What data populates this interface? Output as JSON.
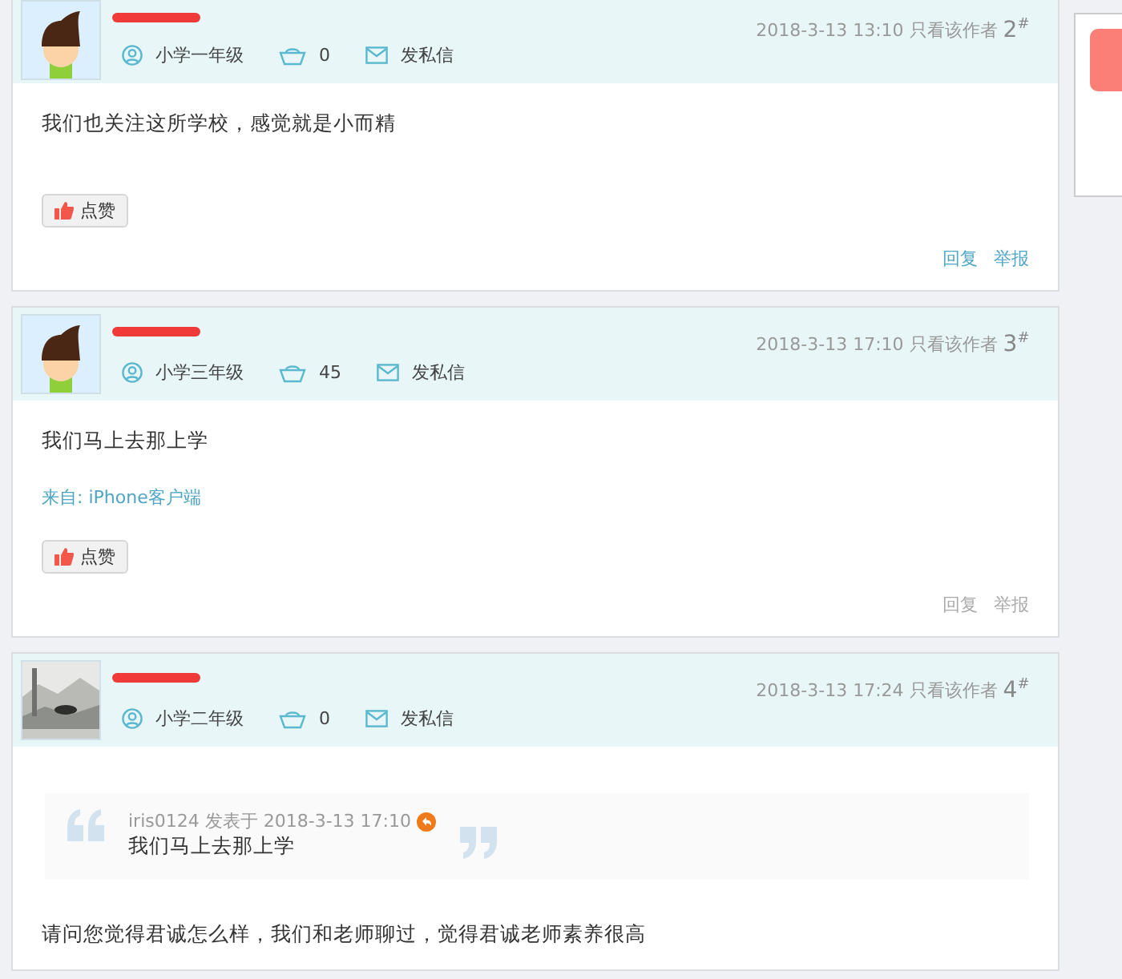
{
  "posts": [
    {
      "avatar": {
        "kind": "cartoon"
      },
      "grade": "小学一年级",
      "coins": "0",
      "message_link": "发私信",
      "time": "2018-3-13 13:10",
      "author_only": "只看该作者",
      "floor": "2$^{#}$",
      "content": "我们也关注这所学校，感觉就是小而精",
      "like_button": "点赞",
      "actions": [
        "回复",
        "举报"
      ],
      "highlighted": true
    },
    {
      "avatar": {
        "kind": "cartoon"
      },
      "grade": "小学三年级",
      "coins": "45",
      "message_link": "发私信",
      "time": "2018-3-13 17:10",
      "author_only": "只看该作者",
      "floor": "3$^{#}$",
      "content": "我们马上去那上学",
      "source": "来自: iPhone客户端",
      "like_button": "点赞",
      "actions": [
        "回复",
        "举报"
      ],
      "highlighted": false
    },
    {
      "grade": "小学二年级",
      "coins": "0",
      "message_link": "发私信",
      "time": "2018-3-13 17:24",
      "author_only": "只看该作者",
      "floor": "4$^{#}$",
      "quote": {
        "meta": "iris0124 发表于 2018-3-13 17:10",
        "text": "我们马上去那上学"
      },
      "content": "请问您觉得君诚怎么样，我们和老师聊过，觉得君诚老师素养很高"
    }
  ]
}
